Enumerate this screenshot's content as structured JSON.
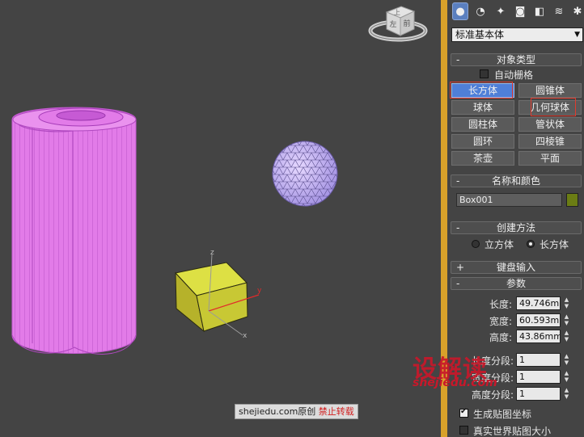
{
  "viewcube": {
    "top_label": "上",
    "front_label": "前",
    "left_label": "左"
  },
  "gizmo": {
    "z": "z",
    "y": "y",
    "x": "x"
  },
  "command_panel": {
    "tabs": [
      "create-icon",
      "shapes-icon",
      "lights-icon",
      "cameras-icon",
      "helpers-icon",
      "spacewarps-icon",
      "systems-icon"
    ],
    "category_dropdown": "标准基本体",
    "object_type": {
      "title": "对象类型",
      "autogrid_label": "自动栅格",
      "autogrid_checked": false,
      "buttons": [
        "长方体",
        "圆锥体",
        "球体",
        "几何球体",
        "圆柱体",
        "管状体",
        "圆环",
        "四棱锥",
        "茶壶",
        "平面"
      ],
      "selected": "长方体"
    },
    "name_color": {
      "title": "名称和颜色",
      "name_value": "Box001",
      "color": "#6b7d14"
    },
    "creation_method": {
      "title": "创建方法",
      "option_cube": "立方体",
      "option_box": "长方体",
      "selected": "长方体"
    },
    "keyboard_entry": {
      "title": "键盘输入",
      "sign": "+"
    },
    "parameters": {
      "title": "参数",
      "sign": "-",
      "length_label": "长度:",
      "length_value": "49.746mm",
      "width_label": "宽度:",
      "width_value": "60.593mm",
      "height_label": "高度:",
      "height_value": "43.86mm",
      "length_segs_label": "长度分段:",
      "length_segs_value": "1",
      "width_segs_label": "宽度分段:",
      "width_segs_value": "1",
      "height_segs_label": "高度分段:",
      "height_segs_value": "1",
      "gen_mapping_label": "生成贴图坐标",
      "gen_mapping_checked": true,
      "real_world_label": "真实世界贴图大小",
      "real_world_checked": false
    },
    "rollout_minus": "-"
  },
  "watermark": {
    "site": "shejiedu.com",
    "original": "原创",
    "forbid": "禁止转载"
  },
  "brand": {
    "title": "设解读",
    "url": "shejiedu.com"
  }
}
